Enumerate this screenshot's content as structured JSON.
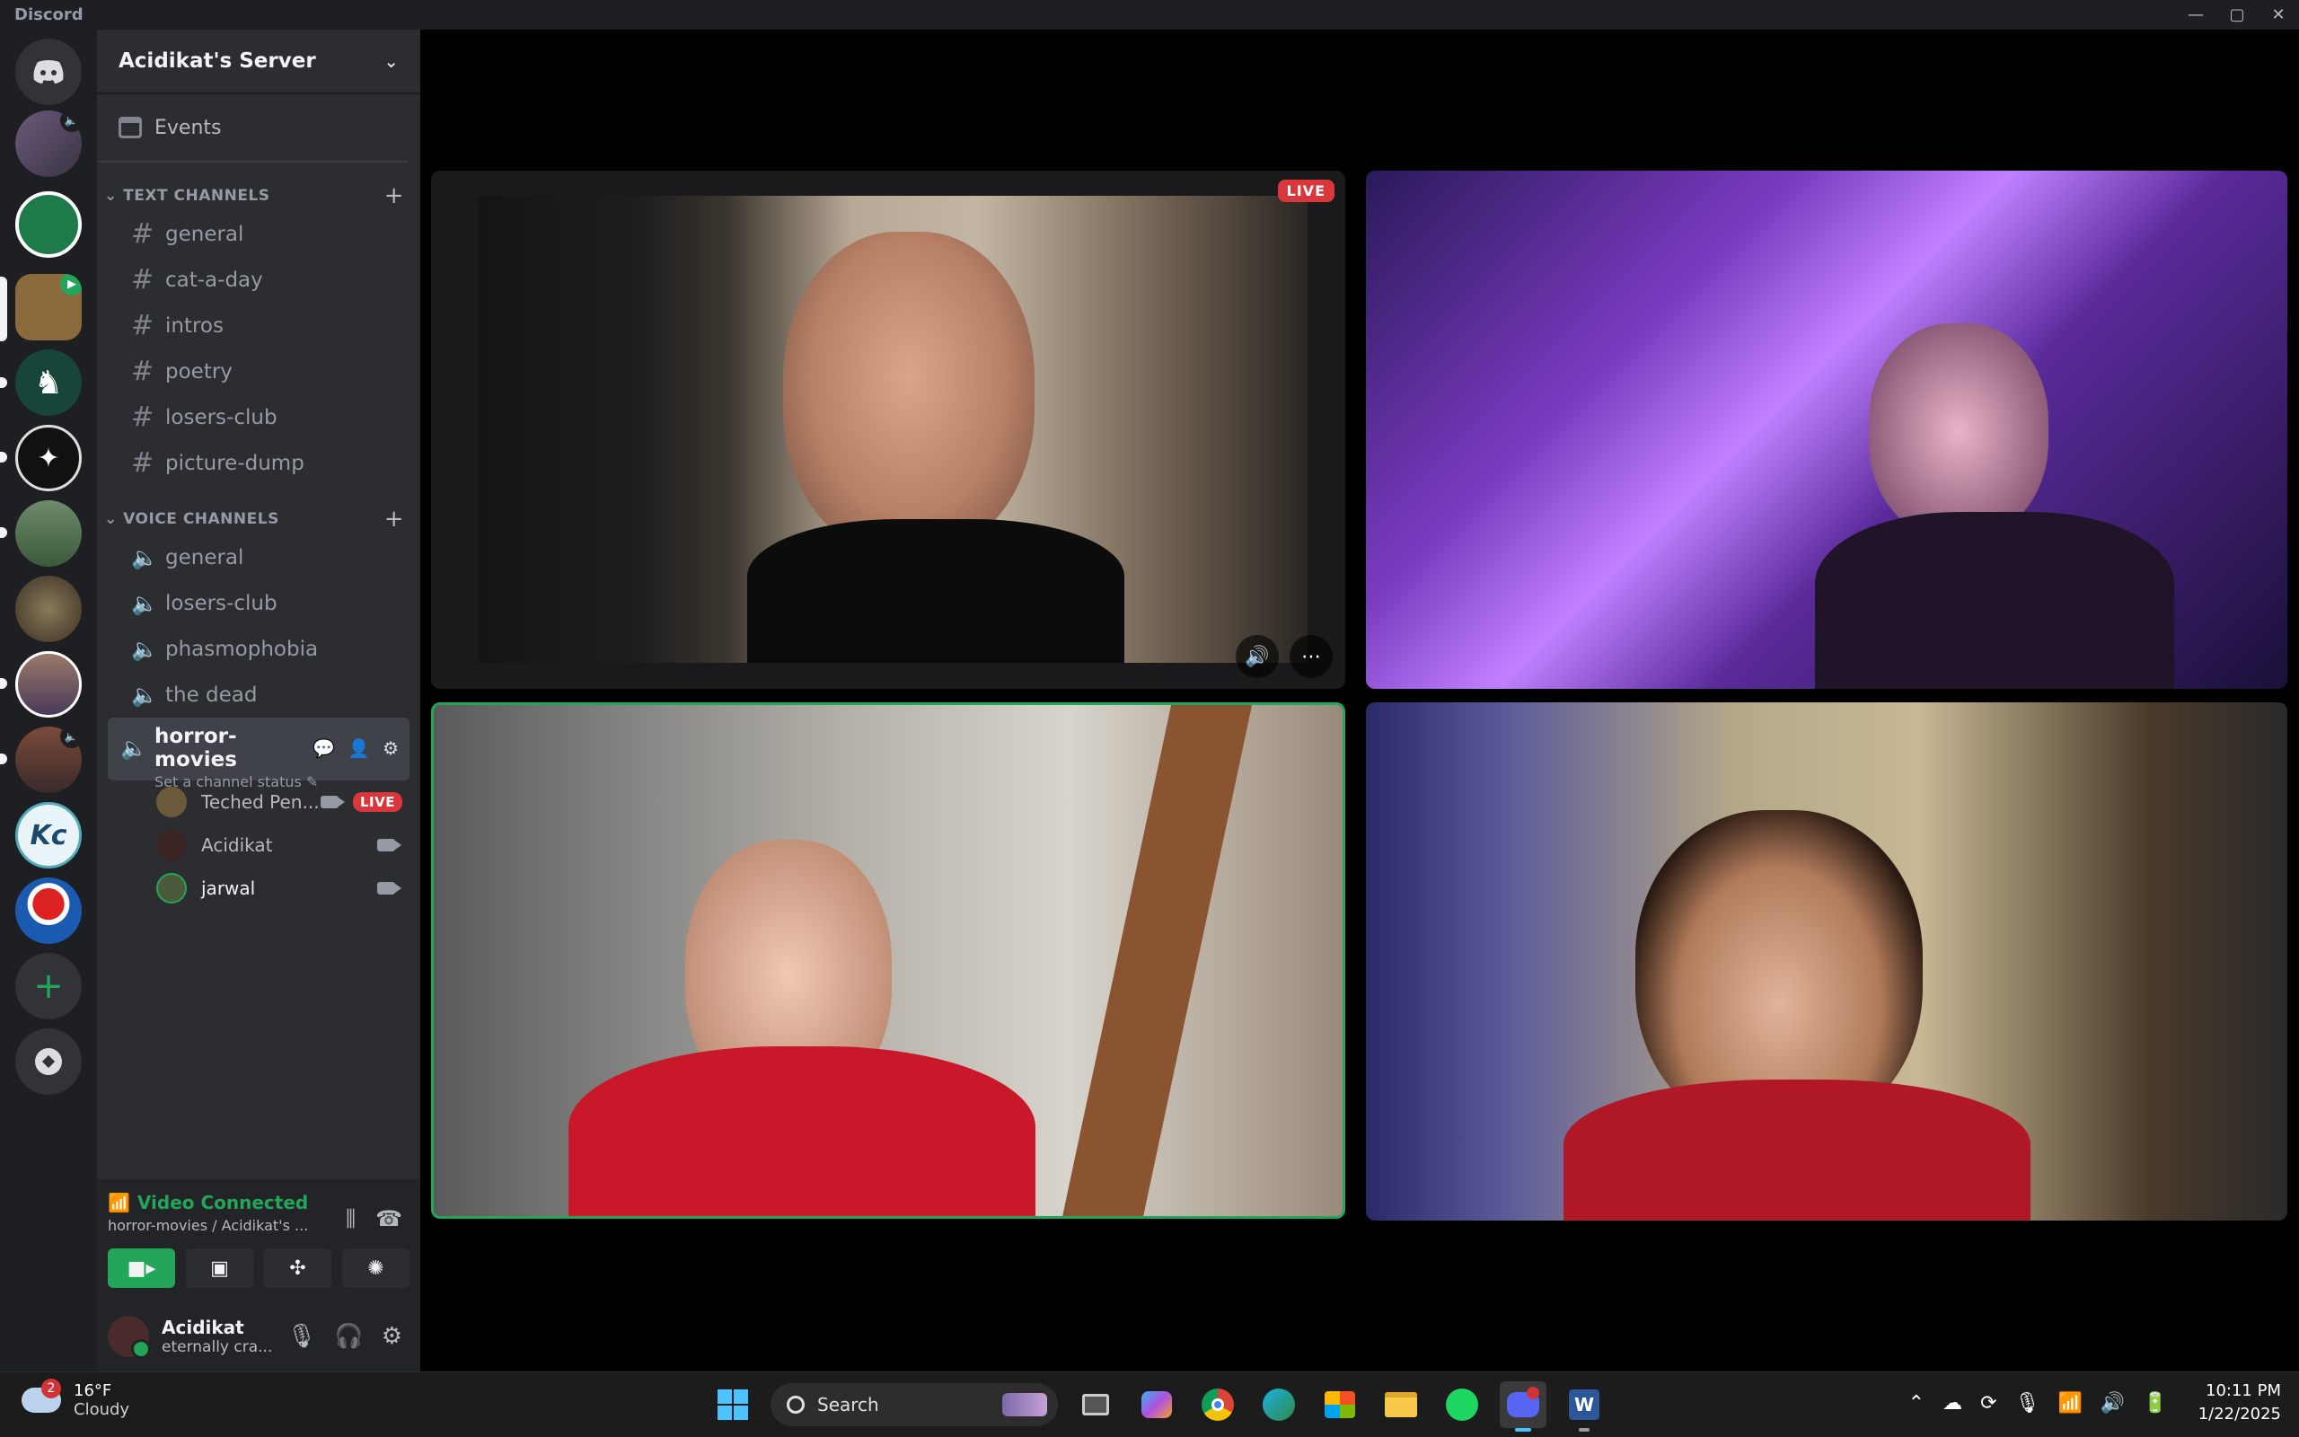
{
  "window": {
    "title": "Discord"
  },
  "server": {
    "name": "Acidikat's Server"
  },
  "events_label": "Events",
  "text_channels": {
    "header": "TEXT CHANNELS",
    "items": [
      "general",
      "cat-a-day",
      "intros",
      "poetry",
      "losers-club",
      "picture-dump"
    ]
  },
  "voice_channels": {
    "header": "VOICE CHANNELS",
    "items": [
      "general",
      "losers-club",
      "phasmophobia",
      "the dead"
    ],
    "active": {
      "name": "horror-movies",
      "status_placeholder": "Set a channel status"
    }
  },
  "voice_users": [
    {
      "name": "Teched Pen...",
      "badge": "LIVE"
    },
    {
      "name": "Acidikat"
    },
    {
      "name": "jarwal"
    }
  ],
  "voice_connection": {
    "status": "Video Connected",
    "location": "horror-movies / Acidikat's ..."
  },
  "account": {
    "name": "Acidikat",
    "status": "eternally cra..."
  },
  "stream": {
    "live_badge": "LIVE"
  },
  "taskbar": {
    "weather": {
      "temp": "16°F",
      "condition": "Cloudy",
      "badge": "2"
    },
    "search_label": "Search",
    "time": "10:11 PM",
    "date": "1/22/2025"
  },
  "colors": {
    "accent_green": "#23a55a",
    "live_red": "#da373c",
    "sidebar": "#2b2d31",
    "rail": "#1e1f22"
  }
}
